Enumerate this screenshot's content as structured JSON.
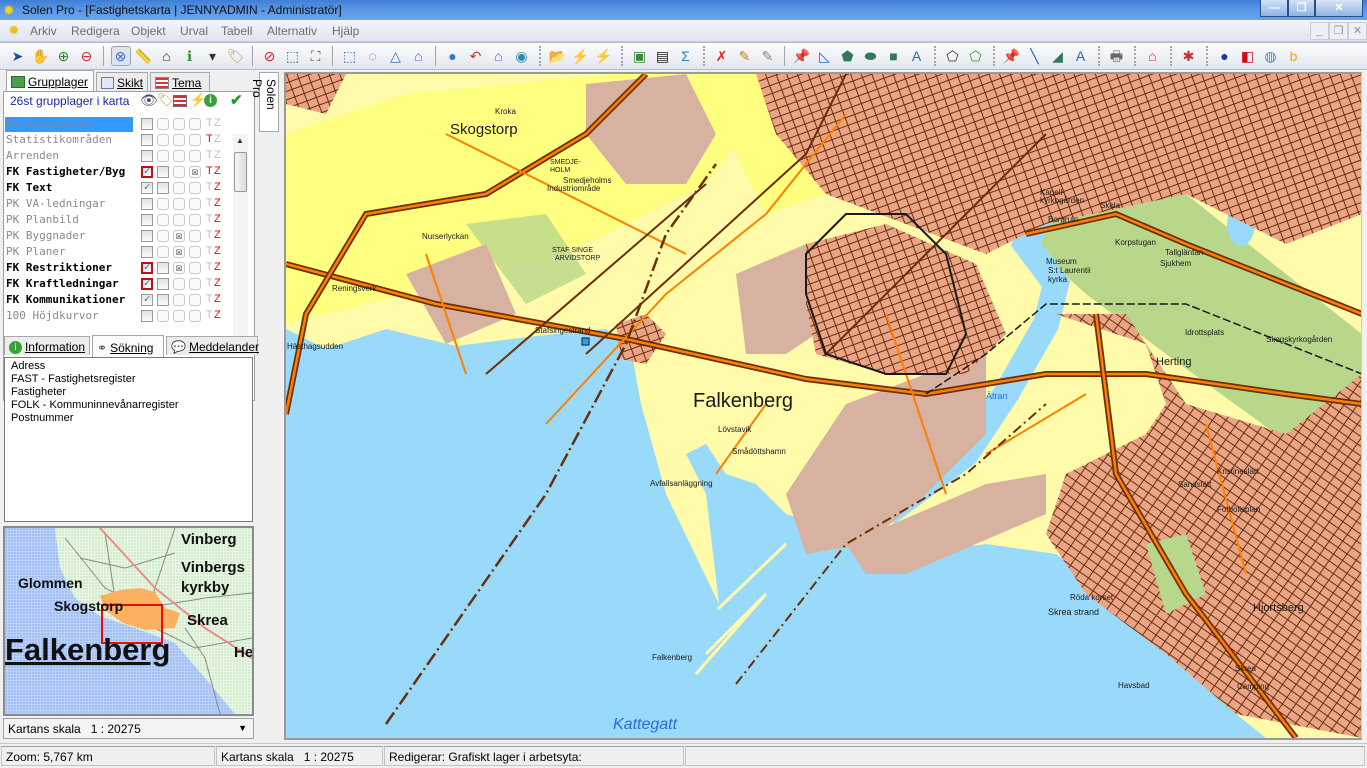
{
  "window": {
    "title": "Solen Pro - [Fastighetskarta | JENNYADMIN - Administratör]",
    "minimize": "—",
    "restore": "❐",
    "close": "✕"
  },
  "menu": {
    "items": [
      "Arkiv",
      "Redigera",
      "Objekt",
      "Urval",
      "Tabell",
      "Alternativ",
      "Hjälp"
    ],
    "mdi_minimize": "_",
    "mdi_restore": "❐",
    "mdi_close": "✕"
  },
  "toolbar": {
    "groups": [
      [
        [
          "pointer-icon",
          "➤",
          "#1d4fa8"
        ],
        [
          "pan-hand-icon",
          "✋",
          "#777"
        ],
        [
          "zoom-in-icon",
          "⊕",
          "#2a8a2a"
        ],
        [
          "zoom-out-icon",
          "⊖",
          "#c03030"
        ]
      ],
      [
        [
          "zoom-box-icon",
          "⊗",
          "#3a6fc0",
          true
        ],
        [
          "ruler-icon",
          "📏",
          "#c08a20"
        ],
        [
          "area-measure-icon",
          "⌂",
          "#333"
        ],
        [
          "info-icon",
          "ℹ",
          "#2a9a2a"
        ],
        [
          "dropdown-arrow-icon",
          "▾",
          "#333"
        ],
        [
          "tag-icon",
          "🏷",
          "#c8a030"
        ]
      ],
      [
        [
          "no-select-icon",
          "⊘",
          "#d02020"
        ],
        [
          "select-rectangle-icon",
          "⬚",
          "#4060a0"
        ],
        [
          "clear-selection-icon",
          "⛶",
          "#555"
        ]
      ],
      [
        [
          "select-box-icon",
          "⬚",
          "#3a70c0"
        ],
        [
          "select-circle-icon",
          "◌",
          "#3a70c0"
        ],
        [
          "select-polygon-icon",
          "△",
          "#3a70c0"
        ],
        [
          "select-shape-icon",
          "⌂",
          "#3a70c0"
        ]
      ],
      [
        [
          "globe-icon",
          "●",
          "#2a7ad0"
        ],
        [
          "zoom-previous-icon",
          "↶",
          "#d03020"
        ],
        [
          "home-view-icon",
          "⌂",
          "#3a70c0"
        ],
        [
          "zoom-search-icon",
          "◉",
          "#2a8ab0"
        ]
      ],
      [
        [
          "open-lightning-folder-icon",
          "📂",
          "#d0a020"
        ],
        [
          "globe-lightning-icon",
          "⚡",
          "#3a8a3a"
        ],
        [
          "lightning-icon",
          "⚡",
          "#e8c020"
        ]
      ],
      [
        [
          "map-click-icon",
          "▣",
          "#3a8a3a"
        ],
        [
          "table-ruler-icon",
          "▤",
          "#222"
        ],
        [
          "sigma-icon",
          "Σ",
          "#2a80c0"
        ]
      ],
      [
        [
          "palette-delete-icon",
          "✗",
          "#d03020"
        ],
        [
          "palette-edit-icon",
          "✎",
          "#c08020"
        ],
        [
          "cursor-edit-icon",
          "✎",
          "#888"
        ]
      ],
      [
        [
          "pin-icon",
          "📌",
          "#1e6fc0"
        ],
        [
          "line-icon",
          "◺",
          "#1e6fc0"
        ],
        [
          "polygon-icon",
          "⬟",
          "#2f7a5a"
        ],
        [
          "ellipse-icon",
          "⬬",
          "#2f7a5a"
        ],
        [
          "rectangle-icon",
          "■",
          "#2f7a5a"
        ],
        [
          "text-icon",
          "A",
          "#1e6fa0"
        ]
      ],
      [
        [
          "polygon-edit-icon",
          "⬠",
          "#333"
        ],
        [
          "polygon-add-icon",
          "⬠",
          "#2a9a2a"
        ]
      ],
      [
        [
          "pin-arrow-icon",
          "📌",
          "#1e6fc0"
        ],
        [
          "line-arrow-icon",
          "╲",
          "#1e5fa0"
        ],
        [
          "polygon-arrow-icon",
          "◢",
          "#2f7a5a"
        ],
        [
          "text-arrow-icon",
          "A",
          "#1e6fa0"
        ]
      ],
      [
        [
          "printer-icon",
          "🖶",
          "#666"
        ]
      ],
      [
        [
          "house-icon",
          "⌂",
          "#d03010"
        ]
      ],
      [
        [
          "bug-icon",
          "✱",
          "#c03030"
        ]
      ],
      [
        [
          "google-earth-icon",
          "●",
          "#1a3a9a"
        ],
        [
          "layers-color-icon",
          "◧",
          "#d01010"
        ],
        [
          "sphere-icon",
          "◍",
          "#3a8ad0"
        ],
        [
          "bing-icon",
          "b",
          "#f5a020"
        ]
      ]
    ]
  },
  "layers_panel": {
    "tabs": [
      "Grupplager",
      "Skikt",
      "Tema"
    ],
    "count_label": "26st grupplager i karta",
    "column_icons": [
      "eye-icon",
      "tag-icon",
      "legend-icon",
      "lightning-icon",
      "info-icon",
      "checkmark-icon"
    ],
    "layers": [
      {
        "name": "Adresspunkter",
        "bold": false,
        "selected": true,
        "visible": false,
        "red": false,
        "c3": false,
        "c4": false,
        "t_red": false,
        "z_red": false
      },
      {
        "name": "Statistikområden",
        "bold": false,
        "selected": false,
        "visible": false,
        "red": false,
        "c3": false,
        "c4": false,
        "t_red": true,
        "z_red": false
      },
      {
        "name": "Arrenden",
        "bold": false,
        "selected": false,
        "visible": false,
        "red": false,
        "c3": false,
        "c4": false,
        "t_red": false,
        "z_red": false
      },
      {
        "name": "FK Fastigheter/Byg",
        "bold": true,
        "selected": false,
        "visible": true,
        "red": true,
        "c3": false,
        "c4": true,
        "t_red": true,
        "z_red": true
      },
      {
        "name": "FK Text",
        "bold": true,
        "selected": false,
        "visible": true,
        "red": false,
        "c3": false,
        "c4": false,
        "t_red": false,
        "z_red": true
      },
      {
        "name": "PK VA-ledningar",
        "bold": false,
        "selected": false,
        "visible": false,
        "red": false,
        "c3": false,
        "c4": false,
        "t_red": false,
        "z_red": true
      },
      {
        "name": "PK Planbild",
        "bold": false,
        "selected": false,
        "visible": false,
        "red": false,
        "c3": false,
        "c4": false,
        "t_red": false,
        "z_red": true
      },
      {
        "name": "PK Byggnader",
        "bold": false,
        "selected": false,
        "visible": false,
        "red": false,
        "c3": true,
        "c4": false,
        "t_red": false,
        "z_red": true
      },
      {
        "name": "PK Planer",
        "bold": false,
        "selected": false,
        "visible": false,
        "red": false,
        "c3": true,
        "c4": false,
        "t_red": false,
        "z_red": true
      },
      {
        "name": "FK Restriktioner",
        "bold": true,
        "selected": false,
        "visible": true,
        "red": true,
        "c3": true,
        "c4": false,
        "t_red": false,
        "z_red": true
      },
      {
        "name": "FK Kraftledningar",
        "bold": true,
        "selected": false,
        "visible": true,
        "red": true,
        "c3": false,
        "c4": false,
        "t_red": false,
        "z_red": true
      },
      {
        "name": "FK Kommunikationer",
        "bold": true,
        "selected": false,
        "visible": true,
        "red": false,
        "c3": false,
        "c4": false,
        "t_red": false,
        "z_red": true
      },
      {
        "name": "100 Höjdkurvor",
        "bold": false,
        "selected": false,
        "visible": false,
        "red": false,
        "c3": false,
        "c4": false,
        "t_red": false,
        "z_red": true
      }
    ],
    "t_label": "T",
    "z_label": "Z"
  },
  "search_panel": {
    "tabs": [
      "Information",
      "Sökning",
      "Meddelander"
    ],
    "active_tab": "Sökning",
    "items": [
      "Adress",
      "FAST - Fastighetsregister",
      "Fastigheter",
      "FOLK - Kommuninnevånarregister",
      "Postnummer"
    ]
  },
  "side_tab": "Solen Pro",
  "overview": {
    "labels": [
      "Vinberg",
      "Vinbergs",
      "kyrkby",
      "Glommen",
      "Skogstorp",
      "Skrea",
      "He",
      "Falkenberg"
    ],
    "scale_select": "Kartans skala   1 : 20275"
  },
  "map": {
    "colors": {
      "water": "#99dafa",
      "sand": "#fffbaa",
      "field": "#ffff80",
      "residential": "#e9a586",
      "industrial": "#d8b2a0",
      "green": "#b9d78a",
      "road": "#ff8000",
      "street": "#6b2f0a"
    },
    "labels": {
      "skogstorp": "Skogstorp",
      "falkenberg": "Falkenberg",
      "kattegatt": "Kattegatt",
      "atran": "Ätran",
      "kroka": "Kroka",
      "smedjeholm": "SMEDJE-",
      "smedjeholm2": "HOLM",
      "smedjeholms": "Smedjeholms",
      "industri": "Industriområde",
      "nurserlyckan": "Nurserlyckan",
      "stafsinge": "STAF SINGE",
      "arvidstorp": "ARVIDSTORP",
      "reningsverk": "Reningsverk",
      "hasthag": "Hästhagsudden",
      "stafsingestrand": "Stafsingestrand",
      "lovstavik": "Lövstavik",
      "smadott": "Smådöttshamn",
      "avfall": "Avfallsanläggning",
      "falk_small": "Falkenberg",
      "kapell": "Kapell-",
      "kapell2": "kyrkogården",
      "skola": "Skola",
      "borgruin": "Borgruin",
      "korpstugan": "Korpstugan",
      "tallglantan": "Tallgläntan",
      "sjukhem": "Sjukhem",
      "museum": "Museum",
      "laurentii": "S:t Laurentii",
      "kyrka": "kyrka",
      "herting": "Herting",
      "idrott": "Idrottsplats",
      "skogskyrk": "Skogskyrkogården",
      "kristine": "Kristineslätt",
      "sandslatt": "Sandslätt",
      "fotboll": "Fotbollsplan",
      "hjortsberg": "Hjortsberg",
      "roda": "Röda korset",
      "skreastrand": "Skrea strand",
      "havsbad": "Havsbad",
      "skrea": "Skrea",
      "camping": "Camping"
    }
  },
  "status": {
    "zoom": "Zoom: 5,767 km",
    "scale": "Kartans skala   1 : 20275",
    "editing": "Redigerar: Grafiskt lager i arbetsyta:"
  }
}
